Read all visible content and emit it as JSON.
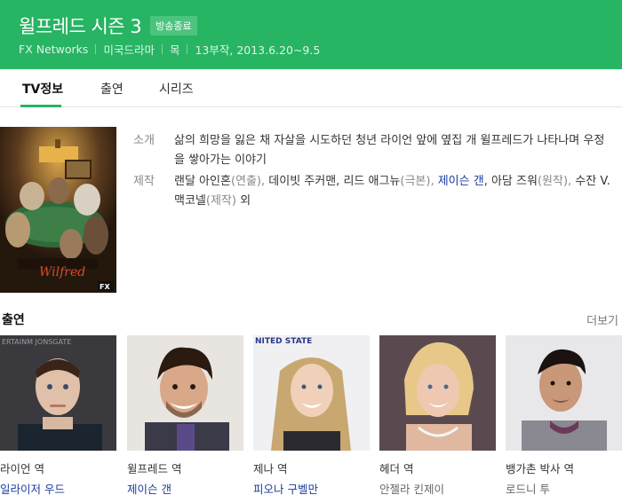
{
  "header": {
    "title": "윌프레드 시즌 3",
    "status_badge": "방송종료",
    "meta": [
      "FX Networks",
      "미국드라마",
      "목",
      "13부작, 2013.6.20~9.5"
    ]
  },
  "tabs": [
    {
      "label": "TV정보",
      "active": true
    },
    {
      "label": "출연",
      "active": false
    },
    {
      "label": "시리즈",
      "active": false
    }
  ],
  "info": {
    "intro_label": "소개",
    "intro_text": "삶의 희망을 잃은 채 자살을 시도하던 청년 라이언 앞에 옆집 개 윌프레드가 나타나며 우정을 쌓아가는 이야기",
    "production_label": "제작",
    "production": [
      {
        "text": "랜달 아인혼",
        "type": "text"
      },
      {
        "text": "(연출), ",
        "type": "note"
      },
      {
        "text": "데이빗 주커맨, 리드 애그뉴",
        "type": "text"
      },
      {
        "text": "(극본), ",
        "type": "note"
      },
      {
        "text": "제이슨 갠",
        "type": "link"
      },
      {
        "text": ", 아담 즈워",
        "type": "text"
      },
      {
        "text": "(원작), ",
        "type": "note"
      },
      {
        "text": "수잔 V. 맥코넬",
        "type": "text"
      },
      {
        "text": "(제작) ",
        "type": "note"
      },
      {
        "text": "외",
        "type": "text"
      }
    ]
  },
  "poster": {
    "title_text": "Wilfred",
    "logo_text": "FX"
  },
  "cast_section": {
    "title": "출연",
    "more_label": "더보기"
  },
  "cast": [
    {
      "role": "라이언 역",
      "name": "일라이저 우드",
      "linked": true,
      "photo_text": "ERTAINM  JONSGATE"
    },
    {
      "role": "윌프레드 역",
      "name": "제이슨 갠",
      "linked": true,
      "photo_text": ""
    },
    {
      "role": "제나 역",
      "name": "피오나 구벨만",
      "linked": true,
      "photo_text": "NITED STATE"
    },
    {
      "role": "헤더 역",
      "name": "안젤라 킨제이",
      "linked": false,
      "photo_text": ""
    },
    {
      "role": "뱅가촌 박사 역",
      "name": "로드니 투",
      "linked": false,
      "photo_text": ""
    }
  ],
  "colors": {
    "header_bg": "#27b463",
    "badge_bg": "#4cc47f",
    "link": "#1a3b9e",
    "tab_active_underline": "#27b463"
  }
}
